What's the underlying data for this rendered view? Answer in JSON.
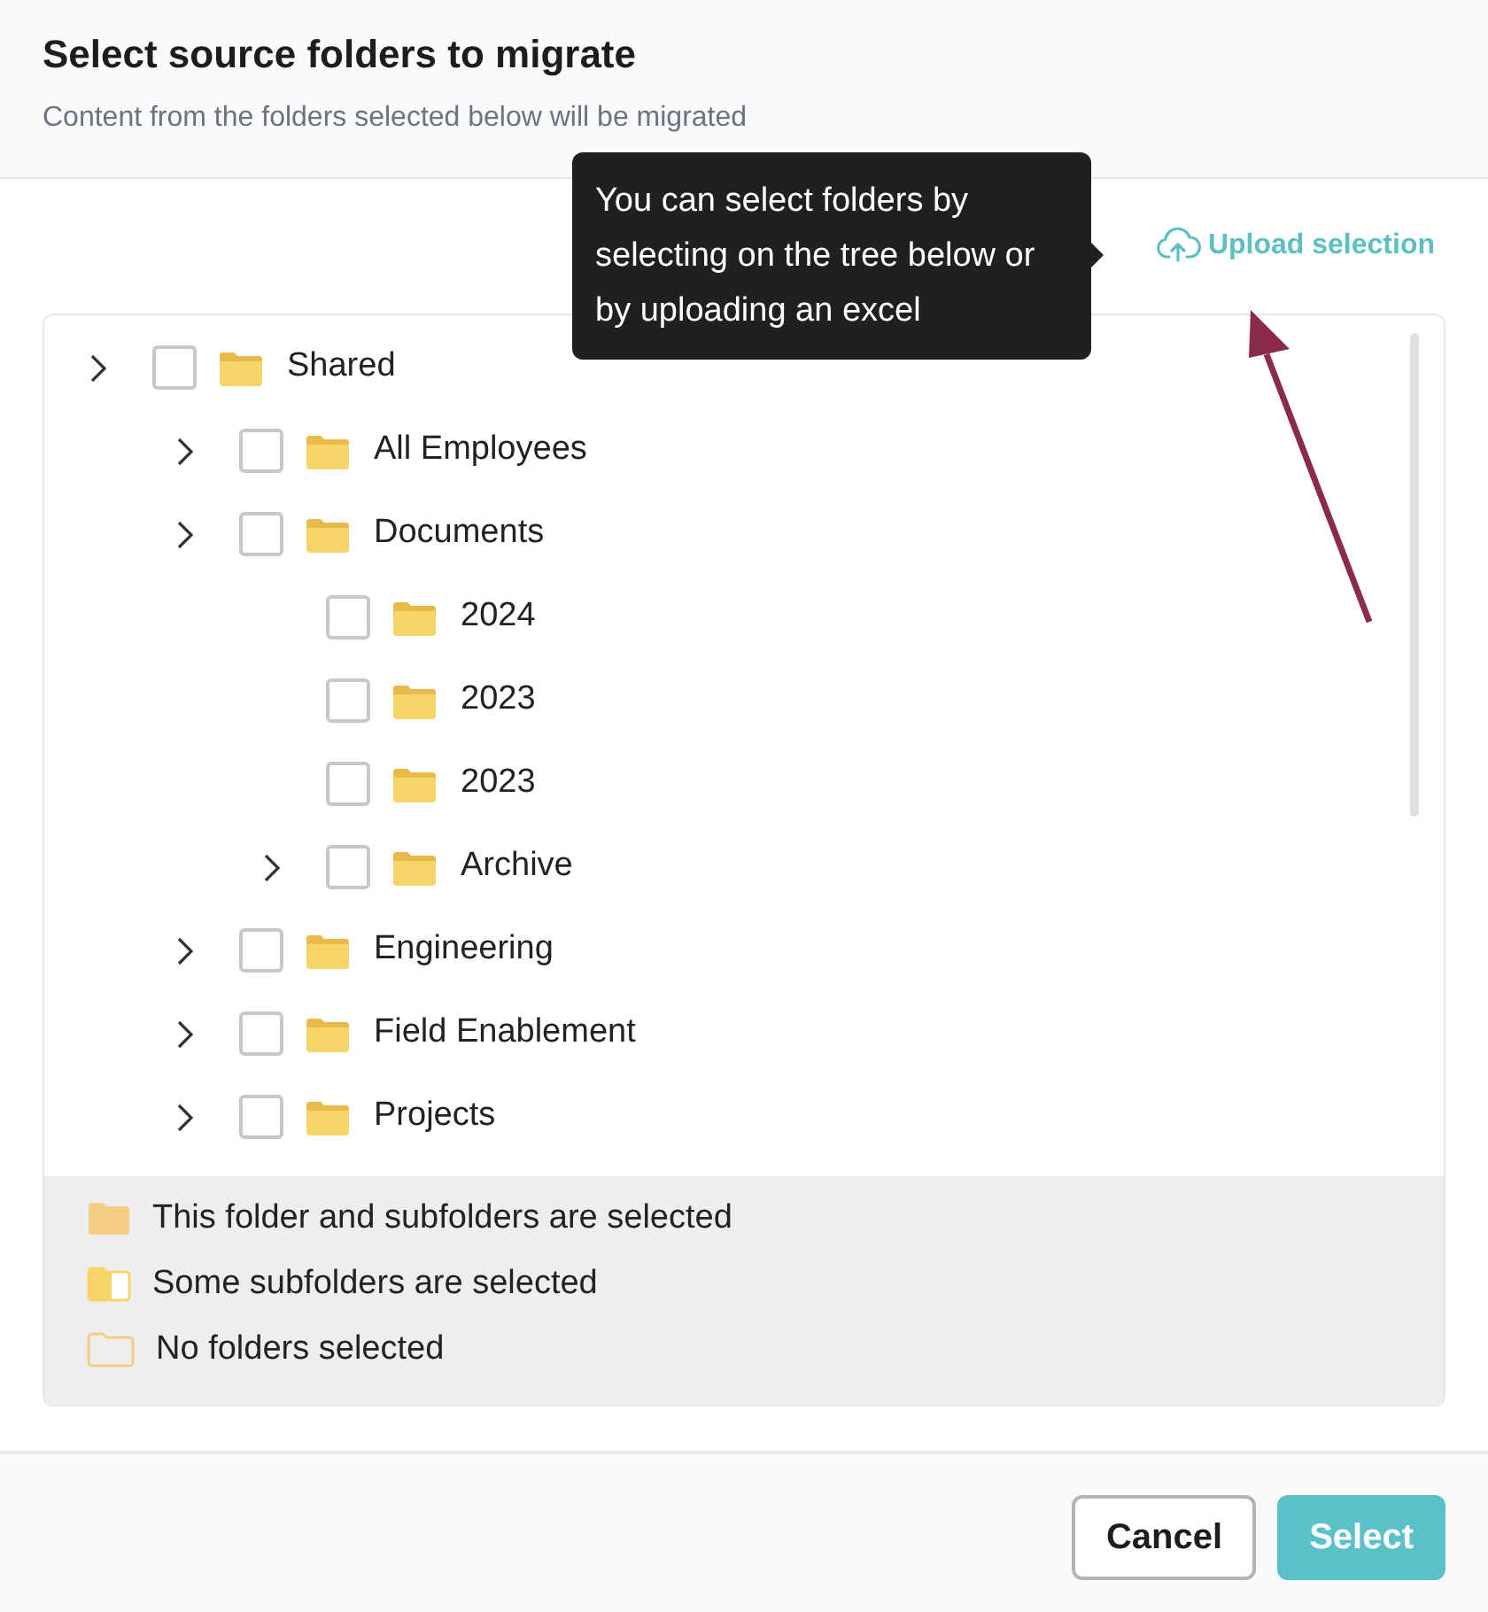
{
  "dialog": {
    "title": "Select source folders to migrate",
    "subtitle": "Content from the folders selected below will be migrated"
  },
  "upload": {
    "label": "Upload selection"
  },
  "tooltip": {
    "text": "You can select folders by selecting on the tree below or by uploading an excel"
  },
  "tree": [
    {
      "label": "Shared",
      "expandable": true,
      "checked": false,
      "children": [
        {
          "label": "All Employees",
          "expandable": true,
          "checked": false
        },
        {
          "label": "Documents",
          "expandable": true,
          "checked": false,
          "children": [
            {
              "label": "2024",
              "expandable": false,
              "checked": false
            },
            {
              "label": "2023",
              "expandable": false,
              "checked": false
            },
            {
              "label": "2023",
              "expandable": false,
              "checked": false
            },
            {
              "label": "Archive",
              "expandable": true,
              "checked": false
            }
          ]
        },
        {
          "label": "Engineering",
          "expandable": true,
          "checked": false
        },
        {
          "label": "Field Enablement",
          "expandable": true,
          "checked": false
        },
        {
          "label": "Projects",
          "expandable": true,
          "checked": false
        }
      ]
    }
  ],
  "legend": [
    {
      "kind": "full",
      "label": "This folder and subfolders are selected"
    },
    {
      "kind": "partial",
      "label": "Some subfolders are selected"
    },
    {
      "kind": "none",
      "label": "No folders selected"
    }
  ],
  "buttons": [
    {
      "kind": "secondary",
      "label": "Cancel"
    },
    {
      "kind": "primary",
      "label": "Select"
    }
  ]
}
